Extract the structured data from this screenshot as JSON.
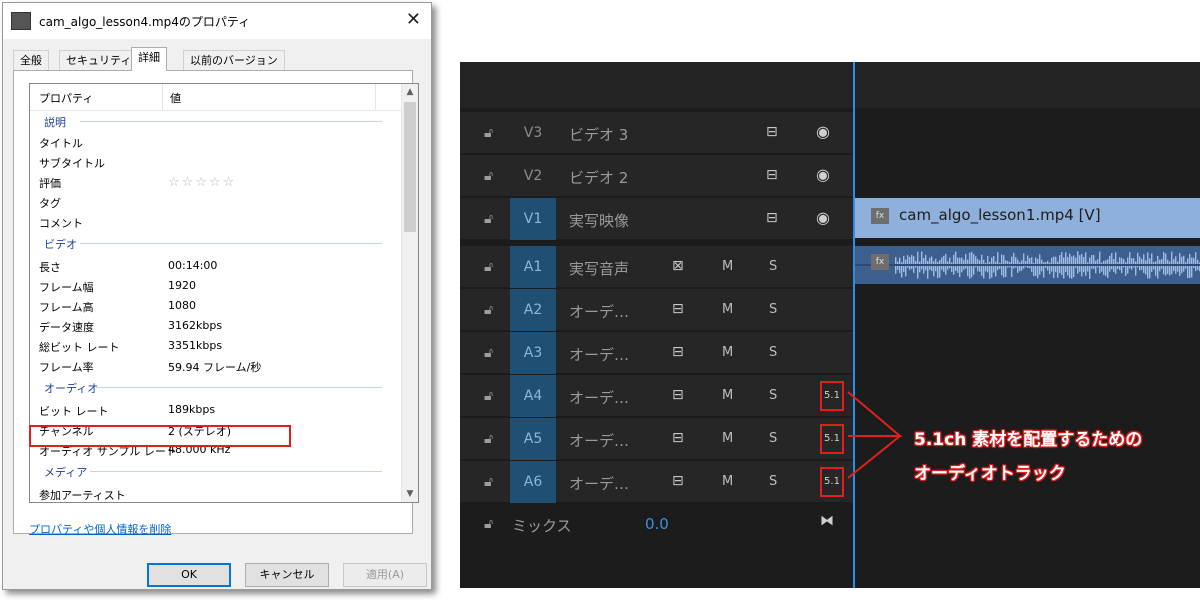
{
  "dialog": {
    "title": "cam_algo_lesson4.mp4のプロパティ",
    "close_glyph": "✕",
    "tabs": [
      "全般",
      "セキュリティ",
      "詳細",
      "以前のバージョン"
    ],
    "columns": {
      "property": "プロパティ",
      "value": "値"
    },
    "groups": {
      "description": "説明",
      "video": "ビデオ",
      "audio": "オーディオ",
      "media": "メディア"
    },
    "rows": {
      "title": {
        "k": "タイトル",
        "v": ""
      },
      "subtitle": {
        "k": "サブタイトル",
        "v": ""
      },
      "rating": {
        "k": "評価",
        "v": "☆☆☆☆☆"
      },
      "tags": {
        "k": "タグ",
        "v": ""
      },
      "comment": {
        "k": "コメント",
        "v": ""
      },
      "length": {
        "k": "長さ",
        "v": "00:14:00"
      },
      "frame_width": {
        "k": "フレーム幅",
        "v": "1920"
      },
      "frame_height": {
        "k": "フレーム高",
        "v": "1080"
      },
      "data_rate": {
        "k": "データ速度",
        "v": "3162kbps"
      },
      "total_bitrate": {
        "k": "総ビット レート",
        "v": "3351kbps"
      },
      "frame_rate": {
        "k": "フレーム率",
        "v": "59.94 フレーム/秒"
      },
      "bitrate": {
        "k": "ビット レート",
        "v": "189kbps"
      },
      "channels": {
        "k": "チャンネル",
        "v": "2 (ステレオ)"
      },
      "sample_rate": {
        "k": "オーディオ サンプル レート",
        "v": "48.000 kHz"
      },
      "contributing_artist": {
        "k": "参加アーティスト",
        "v": ""
      }
    },
    "remove_link": "プロパティや個人情報を削除",
    "buttons": {
      "ok": "OK",
      "cancel": "キャンセル",
      "apply": "適用(A)"
    }
  },
  "timeline": {
    "video_tracks": [
      {
        "id": "V3",
        "label": "ビデオ 3"
      },
      {
        "id": "V2",
        "label": "ビデオ 2"
      },
      {
        "id": "V1",
        "label": "実写映像"
      }
    ],
    "audio_tracks": [
      {
        "id": "A1",
        "label": "実写音声"
      },
      {
        "id": "A2",
        "label": "オーデ…"
      },
      {
        "id": "A3",
        "label": "オーデ…"
      },
      {
        "id": "A4",
        "label": "オーデ…"
      },
      {
        "id": "A5",
        "label": "オーデ…"
      },
      {
        "id": "A6",
        "label": "オーデ…"
      }
    ],
    "mute_label": "M",
    "solo_label": "S",
    "badge_51": "5.1",
    "mix_label": "ミックス",
    "mix_value": "0.0",
    "clip_video": "cam_algo_lesson1.mp4 [V]",
    "fx_label": "fx"
  },
  "annotation": {
    "line1": "5.1ch 素材を配置するための",
    "line2": "オーディオトラック",
    "color": "#e02020"
  }
}
